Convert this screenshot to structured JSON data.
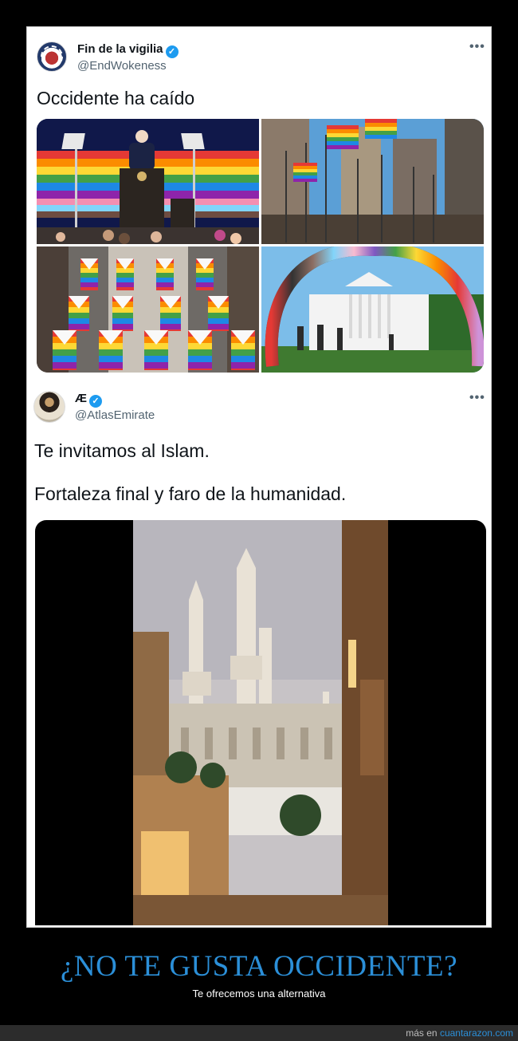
{
  "tweet1": {
    "display_name": "Fin de la vigilia",
    "handle": "@EndWokeness",
    "text": "Occidente ha caído",
    "more_icon": "•••"
  },
  "tweet2": {
    "display_name": "Æ",
    "handle": "@AtlasEmirate",
    "text_line1": "Te invitamos al Islam.",
    "text_line2": "Fortaleza final y faro de la humanidad.",
    "more_icon": "•••"
  },
  "caption": {
    "title": "¿NO TE GUSTA OCCIDENTE?",
    "subtitle": "Te ofrecemos una alternativa"
  },
  "footer": {
    "prefix": "más en",
    "site": "cuantarazon.com"
  },
  "colors": {
    "verified": "#1d9bf0",
    "caption": "#2b8fd8"
  }
}
